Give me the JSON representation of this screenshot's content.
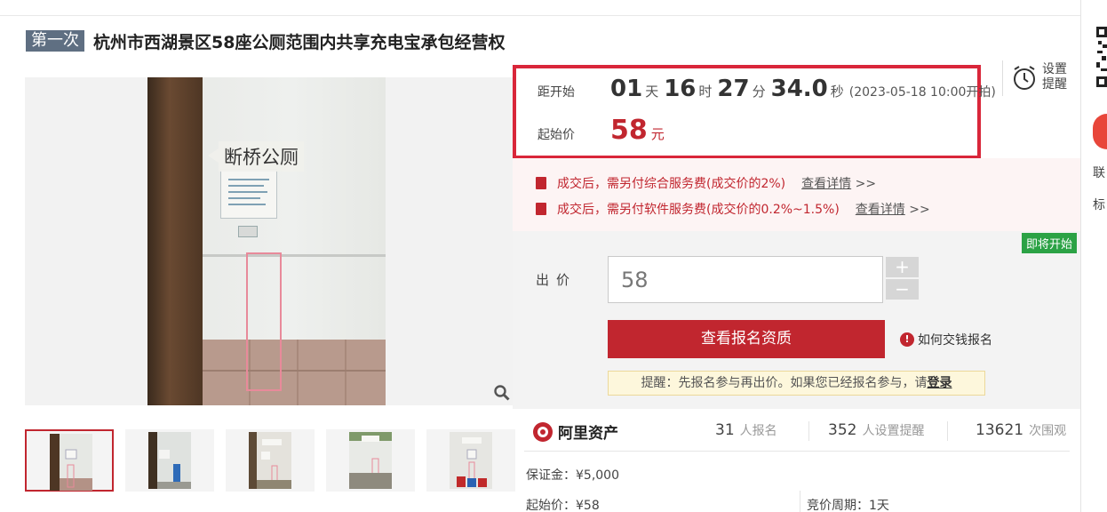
{
  "title": {
    "round_badge": "第一次",
    "text": "杭州市西湖景区58座公厕范围内共享充电宝承包经营权"
  },
  "gallery": {
    "main_label": "断桥公厕",
    "thumbnail_count": 5
  },
  "countdown": {
    "label": "距开始",
    "days": "01",
    "days_unit": "天",
    "hours": "16",
    "hours_unit": "时",
    "minutes": "27",
    "minutes_unit": "分",
    "seconds": "34.0",
    "seconds_unit": "秒",
    "start_time": "(2023-05-18 10:00开拍)"
  },
  "start_price": {
    "label": "起始价",
    "value": "58",
    "unit": "元"
  },
  "reminder_button": {
    "line1": "设置",
    "line2": "提醒"
  },
  "notices": [
    {
      "text": "成交后，需另付综合服务费(成交价的2%)",
      "link": "查看详情",
      "arrow": ">>"
    },
    {
      "text": "成交后，需另付软件服务费(成交价的0.2%~1.5%)",
      "link": "查看详情",
      "arrow": ">>"
    }
  ],
  "bid": {
    "status_tag": "即将开始",
    "label": "出价",
    "input_value": "58",
    "plus": "+",
    "minus": "−",
    "qualification_button": "查看报名资质",
    "how_to_pay": "如何交钱报名",
    "note_prefix": "提醒：先报名参与再出价。如果您已经报名参与，请",
    "note_login": "登录"
  },
  "stats": {
    "brand": "阿里资产",
    "registered_count": "31",
    "registered_label": "人报名",
    "reminder_count": "352",
    "reminder_label": "人设置提醒",
    "views_count": "13621",
    "views_label": "次围观"
  },
  "details": {
    "deposit": "保证金：¥5,000",
    "start_price": "起始价：¥58",
    "cycle": "竞价周期：1天"
  },
  "sidebar": {
    "text1": "联",
    "text2": "标"
  },
  "colors": {
    "accent_red": "#c1262f",
    "badge_gray": "#5f6f82",
    "status_green": "#2ba245"
  }
}
